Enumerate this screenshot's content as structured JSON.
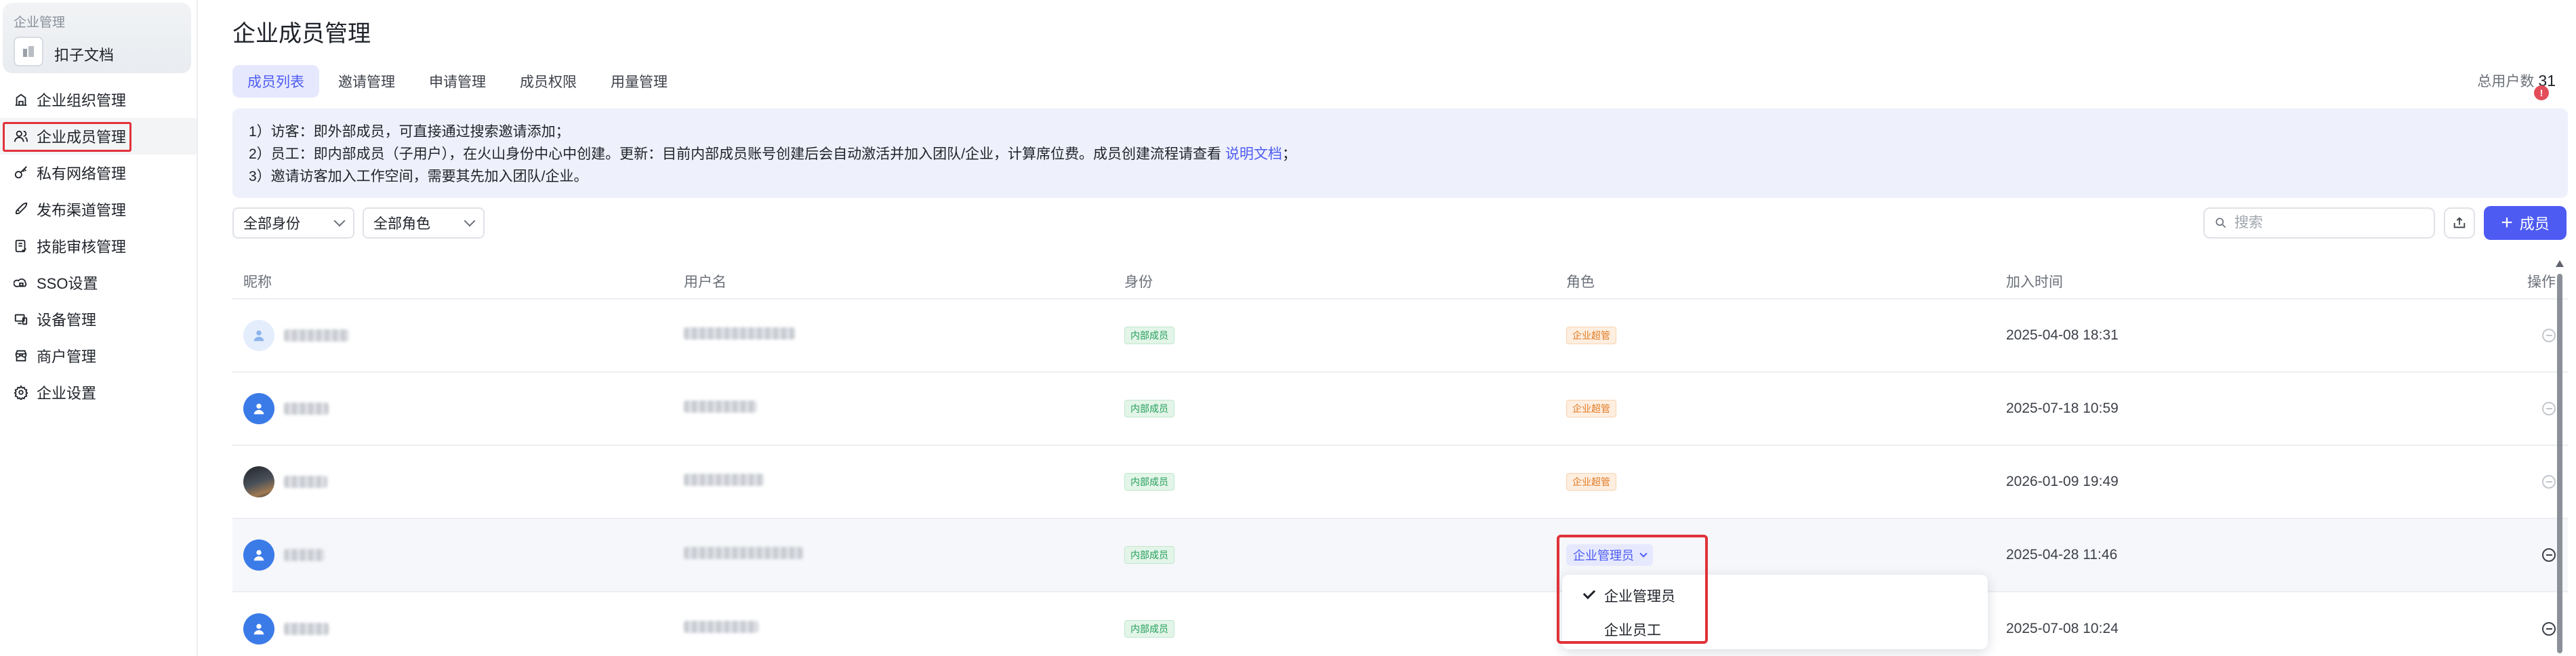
{
  "workspace": {
    "caption": "企业管理",
    "name": "扣子文档"
  },
  "sidebar": {
    "items": [
      {
        "label": "企业组织管理",
        "icon": "organization-icon"
      },
      {
        "label": "企业成员管理",
        "icon": "members-icon",
        "active": true
      },
      {
        "label": "私有网络管理",
        "icon": "key-icon"
      },
      {
        "label": "发布渠道管理",
        "icon": "rocket-icon"
      },
      {
        "label": "技能审核管理",
        "icon": "review-icon"
      },
      {
        "label": "SSO设置",
        "icon": "cloud-lock-icon"
      },
      {
        "label": "设备管理",
        "icon": "device-icon"
      },
      {
        "label": "商户管理",
        "icon": "store-icon"
      },
      {
        "label": "企业设置",
        "icon": "gear-icon"
      }
    ]
  },
  "page": {
    "title": "企业成员管理"
  },
  "tabs": [
    {
      "label": "成员列表",
      "active": true
    },
    {
      "label": "邀请管理"
    },
    {
      "label": "申请管理"
    },
    {
      "label": "成员权限"
    },
    {
      "label": "用量管理"
    }
  ],
  "summary": {
    "total_label": "总用户数",
    "total_value": "31",
    "alert_badge": "!"
  },
  "notice": {
    "line1": "1）访客：即外部成员，可直接通过搜索邀请添加；",
    "line2_prefix": "2）员工：即内部成员（子用户），在火山身份中心中创建。更新：目前内部成员账号创建后会自动激活并加入团队/企业，计算席位费。成员创建流程请查看",
    "line2_link": "说明文档",
    "line2_suffix": "；",
    "line3": "3）邀请访客加入工作空间，需要其先加入团队/企业。"
  },
  "filters": {
    "identity": "全部身份",
    "role": "全部角色"
  },
  "search": {
    "placeholder": "搜索",
    "value": ""
  },
  "toolbar": {
    "add_label": "成员",
    "export_icon": "export-icon"
  },
  "table": {
    "headers": {
      "nickname": "昵称",
      "username": "用户名",
      "identity": "身份",
      "role": "角色",
      "joined": "加入时间",
      "actions": "操作"
    },
    "rows": [
      {
        "identity": "内部成员",
        "role": "企业超管",
        "joined": "2025-04-08 18:31",
        "avatar": "light"
      },
      {
        "identity": "内部成员",
        "role": "企业超管",
        "joined": "2025-07-18 10:59",
        "avatar": "blue"
      },
      {
        "identity": "内部成员",
        "role": "企业超管",
        "joined": "2026-01-09 19:49",
        "avatar": "photo"
      },
      {
        "identity": "内部成员",
        "role": "企业管理员",
        "joined": "2025-04-28 11:46",
        "avatar": "blue",
        "editing": true
      },
      {
        "identity": "内部成员",
        "role": "",
        "joined": "2025-07-08 10:24",
        "avatar": "blue"
      }
    ]
  },
  "role_dropdown": {
    "options": [
      {
        "label": "企业管理员",
        "selected": true
      },
      {
        "label": "企业员工",
        "selected": false
      }
    ]
  },
  "colors": {
    "accent": "#4e5bf2",
    "highlight": "#e0323a",
    "tag_green": "#239e5a",
    "tag_orange": "#e27b23"
  }
}
